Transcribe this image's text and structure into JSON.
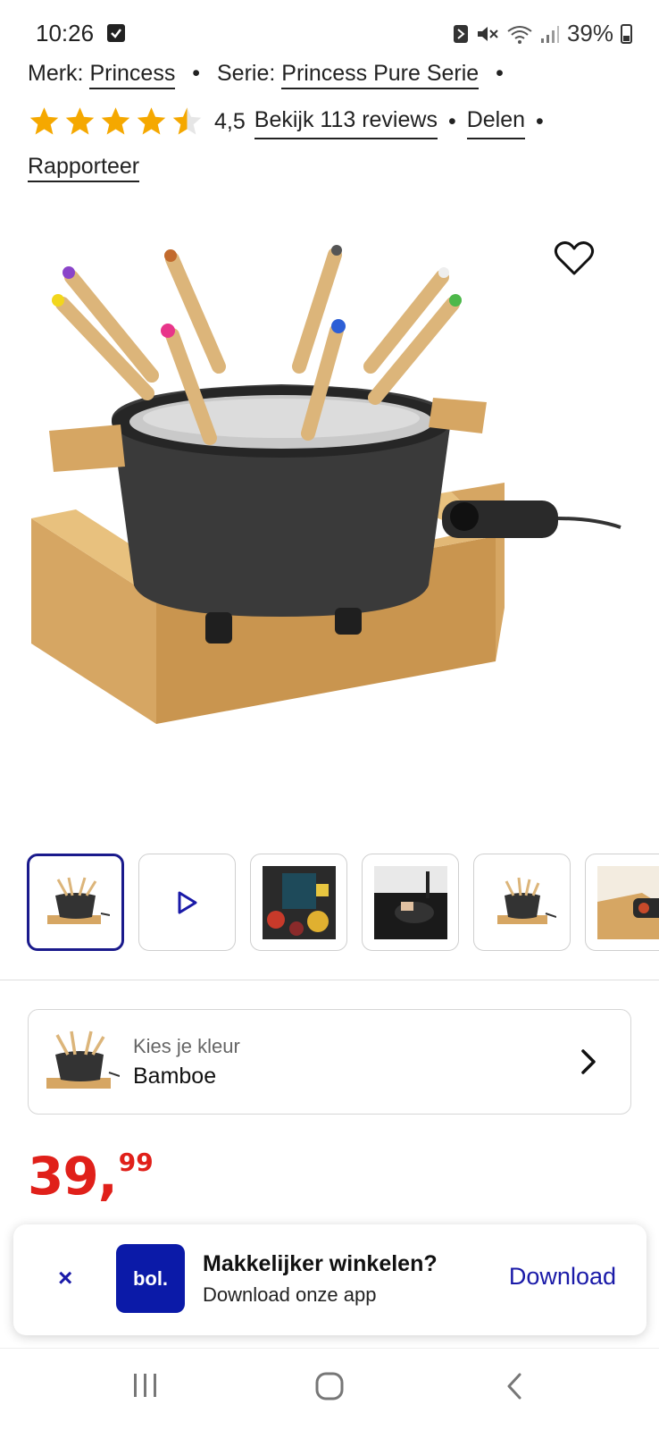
{
  "status": {
    "time": "10:26",
    "battery": "39%"
  },
  "meta": {
    "brand_label": "Merk:",
    "brand_value": "Princess",
    "series_label": "Serie:",
    "series_value": "Princess Pure Serie",
    "rating": "4,5",
    "rating_value": 4.5,
    "rating_max": 5,
    "reviews_link": "Bekijk 113 reviews",
    "share_link": "Delen",
    "report_link": "Rapporteer",
    "separator": "•"
  },
  "gallery": {
    "favorite_icon": "heart-outline-icon",
    "thumbnails": [
      {
        "kind": "product-image",
        "active": true
      },
      {
        "kind": "video",
        "icon": "play-icon"
      },
      {
        "kind": "recipe-book-image"
      },
      {
        "kind": "kitchen-sink-image"
      },
      {
        "kind": "product-image"
      },
      {
        "kind": "detail-image"
      }
    ]
  },
  "color_selector": {
    "label": "Kies je kleur",
    "value": "Bamboe",
    "icon": "chevron-right-icon"
  },
  "price": {
    "main": "39,",
    "cents": "99",
    "color": "#e0201a"
  },
  "app_banner": {
    "close": "×",
    "logo": "bol.",
    "title": "Makkelijker winkelen?",
    "subtitle": "Download onze app",
    "cta": "Download",
    "accent": "#0b1aa8"
  }
}
